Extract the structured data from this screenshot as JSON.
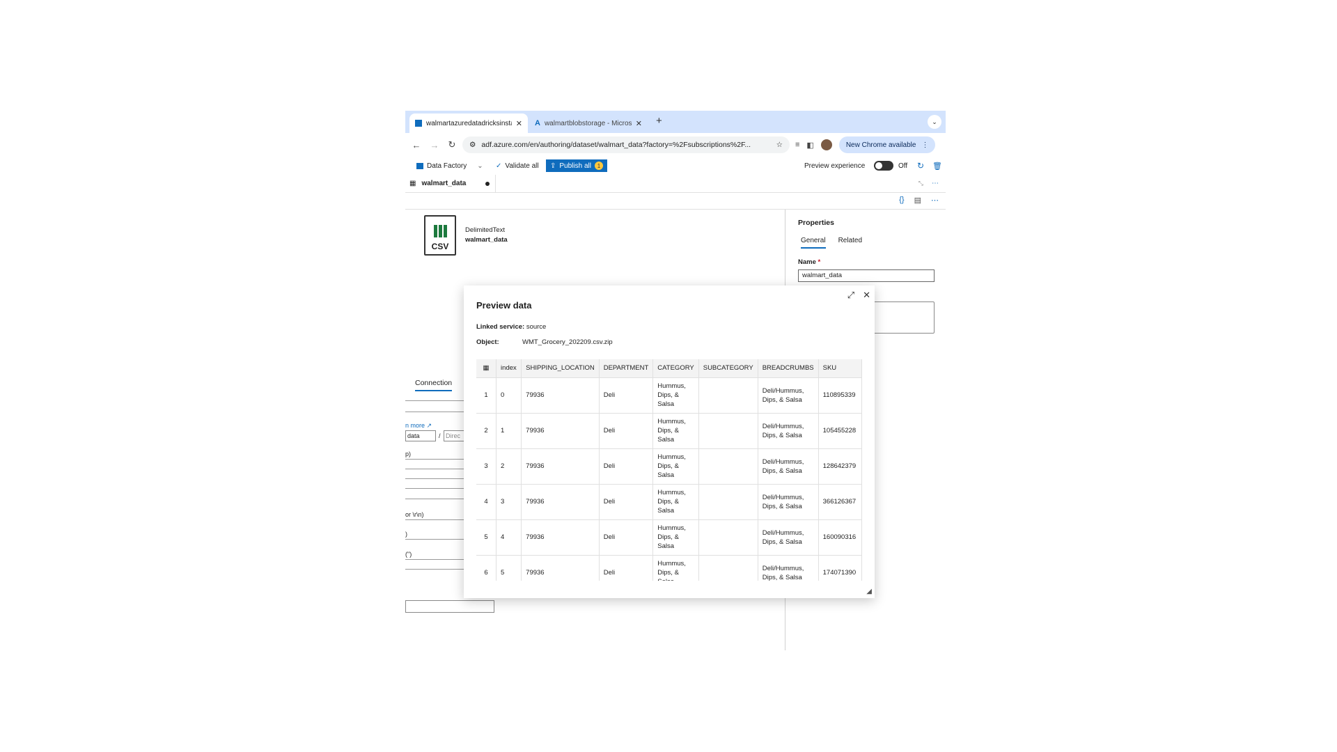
{
  "browser": {
    "tabs": [
      {
        "title": "walmartazuredatadricksinsta",
        "close": "✕"
      },
      {
        "title": "walmartblobstorage - Micros",
        "close": "✕"
      }
    ],
    "new_tab": "+",
    "url": "adf.azure.com/en/authoring/dataset/walmart_data?factory=%2Fsubscriptions%2F...",
    "new_chrome_label": "New Chrome available"
  },
  "adf_toolbar": {
    "factory_label": "Data Factory",
    "validate_label": "Validate all",
    "publish_label": "Publish all",
    "publish_count": "1",
    "preview_label": "Preview experience",
    "toggle_label": "Off"
  },
  "doc_tab": {
    "label": "walmart_data"
  },
  "dataset": {
    "type": "DelimitedText",
    "name": "walmart_data",
    "icon_text": "CSV"
  },
  "left_form": {
    "connection_tab": "Connection",
    "learn_more": "n more",
    "path_fragment": "data",
    "directory_placeholder": "Direc",
    "frag_1": "p)",
    "frag_2": "or \\r\\n)",
    "frag_3": ")",
    "frag_4": "(\")",
    "path_sep": "/"
  },
  "properties": {
    "title": "Properties",
    "tabs": [
      "General",
      "Related"
    ],
    "name_label": "Name",
    "required_mark": "*",
    "name_value": "walmart_data"
  },
  "preview": {
    "title": "Preview data",
    "linked_service_label": "Linked service:",
    "linked_service_value": "source",
    "object_label": "Object:",
    "object_value": "WMT_Grocery_202209.csv.zip",
    "columns": [
      "index",
      "SHIPPING_LOCATION",
      "DEPARTMENT",
      "CATEGORY",
      "SUBCATEGORY",
      "BREADCRUMBS",
      "SKU"
    ],
    "rows": [
      {
        "n": "1",
        "index": "0",
        "loc": "79936",
        "dept": "Deli",
        "cat": "Hummus, Dips, & Salsa",
        "sub": "",
        "crumbs": "Deli/Hummus, Dips, & Salsa",
        "sku": "110895339"
      },
      {
        "n": "2",
        "index": "1",
        "loc": "79936",
        "dept": "Deli",
        "cat": "Hummus, Dips, & Salsa",
        "sub": "",
        "crumbs": "Deli/Hummus, Dips, & Salsa",
        "sku": "105455228"
      },
      {
        "n": "3",
        "index": "2",
        "loc": "79936",
        "dept": "Deli",
        "cat": "Hummus, Dips, & Salsa",
        "sub": "",
        "crumbs": "Deli/Hummus, Dips, & Salsa",
        "sku": "128642379"
      },
      {
        "n": "4",
        "index": "3",
        "loc": "79936",
        "dept": "Deli",
        "cat": "Hummus, Dips, & Salsa",
        "sub": "",
        "crumbs": "Deli/Hummus, Dips, & Salsa",
        "sku": "366126367"
      },
      {
        "n": "5",
        "index": "4",
        "loc": "79936",
        "dept": "Deli",
        "cat": "Hummus, Dips, & Salsa",
        "sub": "",
        "crumbs": "Deli/Hummus, Dips, & Salsa",
        "sku": "160090316"
      },
      {
        "n": "6",
        "index": "5",
        "loc": "79936",
        "dept": "Deli",
        "cat": "Hummus, Dips, & Salsa",
        "sub": "",
        "crumbs": "Deli/Hummus, Dips, & Salsa",
        "sku": "174071390"
      }
    ]
  }
}
